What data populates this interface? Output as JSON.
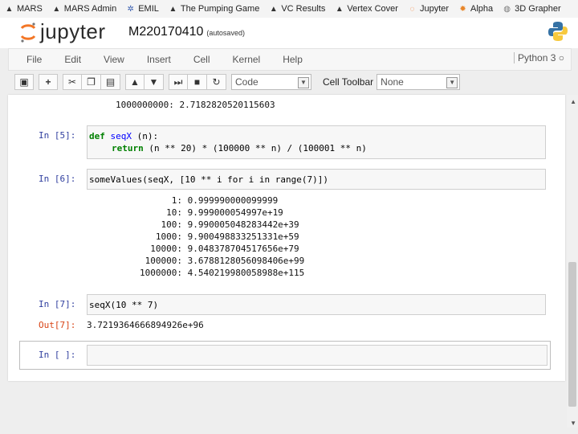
{
  "bookmarks": [
    {
      "label": "MARS",
      "icon": "hat-icon"
    },
    {
      "label": "MARS Admin",
      "icon": "hat-icon"
    },
    {
      "label": "EMIL",
      "icon": "gear-icon"
    },
    {
      "label": "The Pumping Game",
      "icon": "hat-icon"
    },
    {
      "label": "VC Results",
      "icon": "hat-icon"
    },
    {
      "label": "Vertex Cover",
      "icon": "hat-icon"
    },
    {
      "label": "Jupyter",
      "icon": "jupyter-icon"
    },
    {
      "label": "Alpha",
      "icon": "sun-icon"
    },
    {
      "label": "3D Grapher",
      "icon": "globe-icon"
    }
  ],
  "header": {
    "logo_text": "jupyter",
    "notebook_name": "M220170410",
    "save_status": "(autosaved)"
  },
  "menu": [
    "File",
    "Edit",
    "View",
    "Insert",
    "Cell",
    "Kernel",
    "Help"
  ],
  "kernel_name": "Python 3",
  "toolbar": {
    "cell_type": "Code",
    "cell_toolbar_label": "Cell Toolbar",
    "cell_toolbar_value": "None"
  },
  "cells": {
    "prev_output_partial": "1000000000: 2.7182820520115603",
    "cell5": {
      "prompt": "In [5]:",
      "line1_kw": "def",
      "line1_name": "seqX",
      "line1_rest": " (n):",
      "line2_kw": "return",
      "line2_rest": " (n ** 20) * (100000 ** n) / (100001 ** n)"
    },
    "cell6": {
      "prompt": "In [6]:",
      "code": "someValues(seqX, [10 ** i for i in range(7)])",
      "output": [
        "      1: 0.999990000099999",
        "     10: 9.999000054997e+19",
        "    100: 9.990005048283442e+39",
        "   1000: 9.900498833251331e+59",
        "  10000: 9.048378704517656e+79",
        " 100000: 3.6788128056098406e+99",
        "1000000: 4.540219980058988e+115"
      ]
    },
    "cell7": {
      "prompt": "In [7]:",
      "code": "seqX(10 ** 7)",
      "out_prompt": "Out[7]:",
      "output": "3.7219364666894926e+96"
    },
    "cell8": {
      "prompt": "In [ ]:"
    }
  },
  "colors": {
    "in_prompt": "#303f9f",
    "out_prompt": "#d84315",
    "keyword": "#008000",
    "operator": "#aa22ff"
  }
}
